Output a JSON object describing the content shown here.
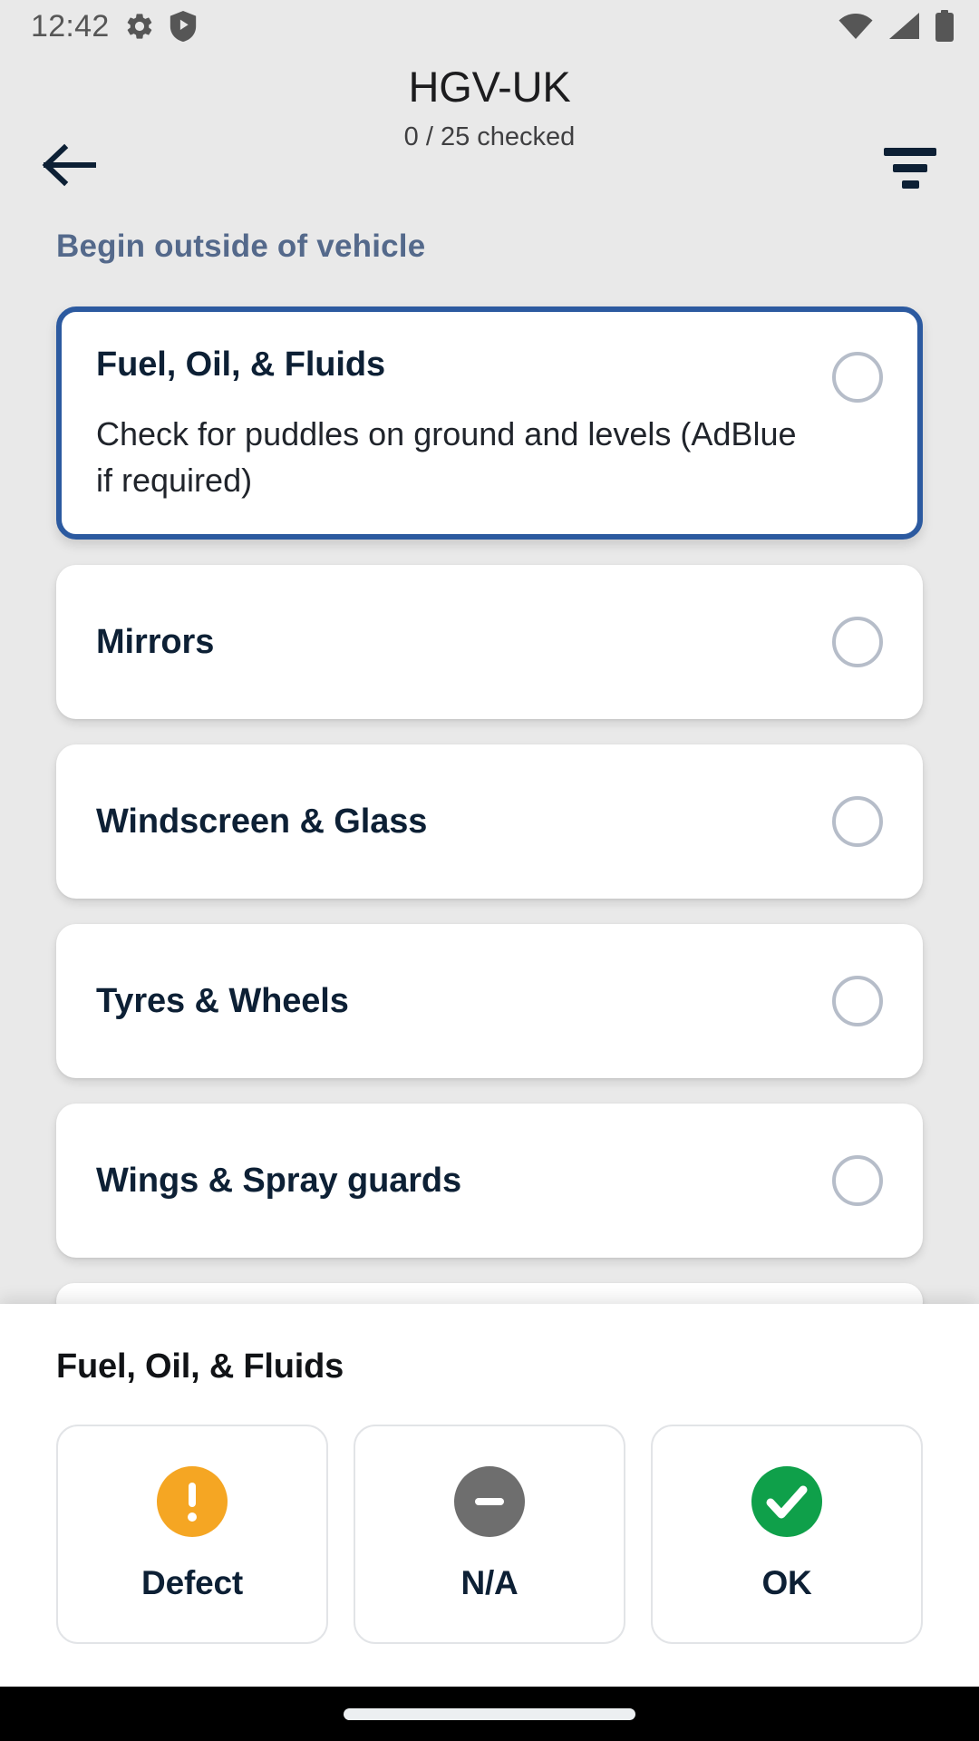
{
  "status_bar": {
    "time": "12:42",
    "left_icons": [
      {
        "name": "gear-icon",
        "label": "settings"
      },
      {
        "name": "shield-play-icon",
        "label": "protected-media"
      }
    ],
    "right_icons": [
      {
        "name": "wifi-icon",
        "label": "wifi"
      },
      {
        "name": "cellular-signal-icon",
        "label": "signal"
      },
      {
        "name": "battery-icon",
        "label": "battery"
      }
    ]
  },
  "header": {
    "back_icon": "arrow-left-icon",
    "title": "HGV-UK",
    "subtitle": "0 / 25 checked",
    "checked_count": 0,
    "total_count": 25,
    "filter_icon": "filter-icon"
  },
  "list": {
    "section_title": "Begin outside of vehicle",
    "items": [
      {
        "title": "Fuel, Oil, & Fluids",
        "description": "Check for puddles on ground and levels (AdBlue if required)",
        "selected": true,
        "status": "unchecked"
      },
      {
        "title": "Mirrors",
        "description": "",
        "selected": false,
        "status": "unchecked"
      },
      {
        "title": "Windscreen & Glass",
        "description": "",
        "selected": false,
        "status": "unchecked"
      },
      {
        "title": "Tyres & Wheels",
        "description": "",
        "selected": false,
        "status": "unchecked"
      },
      {
        "title": "Wings & Spray guards",
        "description": "",
        "selected": false,
        "status": "unchecked"
      }
    ]
  },
  "bottom_sheet": {
    "title": "Fuel, Oil, & Fluids",
    "actions": [
      {
        "label": "Defect",
        "icon": "exclamation-circle-icon",
        "color": "#f5a623"
      },
      {
        "label": "N/A",
        "icon": "minus-circle-icon",
        "color": "#6e6e6e"
      },
      {
        "label": "OK",
        "icon": "check-circle-icon",
        "color": "#0fa04a"
      }
    ]
  },
  "nav_bar": {
    "gesture_pill": "home-indicator"
  },
  "colors": {
    "background": "#e9e9e9",
    "card": "#ffffff",
    "selected_border": "#2c5aa0",
    "section_title": "#54698b",
    "title_text": "#0d2035",
    "radio_outline": "#b6bdc9",
    "defect": "#f5a623",
    "na": "#6e6e6e",
    "ok": "#0fa04a"
  }
}
